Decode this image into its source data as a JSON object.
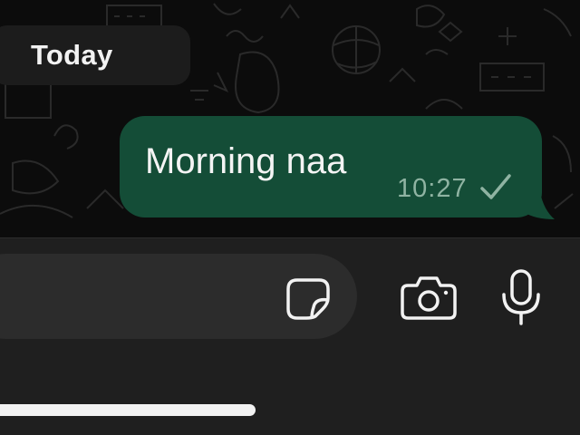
{
  "chat": {
    "date_divider": "Today",
    "message": {
      "text": "Morning naa",
      "time": "10:27",
      "status_icon": "single-check-icon",
      "bubble_color": "#144d37"
    }
  },
  "composer": {
    "input_placeholder": "",
    "icons": [
      "sticker-icon",
      "camera-icon",
      "microphone-icon"
    ]
  },
  "colors": {
    "background": "#0c0c0c",
    "composer_bar": "#1f1f1f",
    "input_field": "#2c2c2c",
    "time_text": "#8fb3a2"
  }
}
